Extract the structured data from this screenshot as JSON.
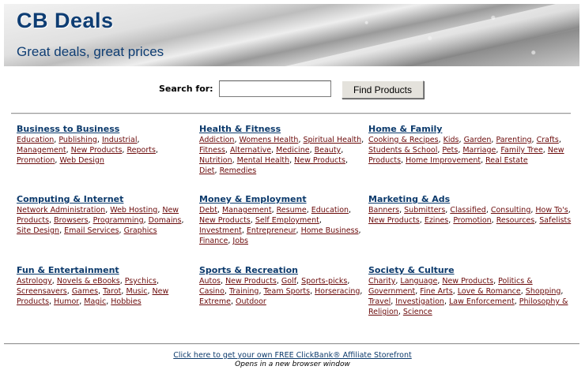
{
  "header": {
    "title": "CB Deals",
    "tagline": "Great deals, great prices"
  },
  "search": {
    "label": "Search for:",
    "value": "",
    "placeholder": "",
    "button_label": "Find Products"
  },
  "categories": [
    {
      "title": "Business to Business",
      "links": [
        "Education",
        "Publishing",
        "Industrial",
        "Management",
        "New Products",
        "Reports",
        "Promotion",
        "Web Design"
      ]
    },
    {
      "title": "Health & Fitness",
      "links": [
        "Addiction",
        "Womens Health",
        "Spiritual Health",
        "Fitness",
        "Alternative",
        "Medicine",
        "Beauty",
        "Nutrition",
        "Mental Health",
        "New Products",
        "Diet",
        "Remedies"
      ]
    },
    {
      "title": "Home & Family",
      "links": [
        "Cooking & Recipes",
        "Kids",
        "Garden",
        "Parenting",
        "Crafts",
        "Students & School",
        "Pets",
        "Marriage",
        "Family Tree",
        "New Products",
        "Home Improvement",
        "Real Estate"
      ]
    },
    {
      "title": "Computing & Internet",
      "links": [
        "Network Administration",
        "Web Hosting",
        "New Products",
        "Browsers",
        "Programming",
        "Domains",
        "Site Design",
        "Email Services",
        "Graphics"
      ]
    },
    {
      "title": "Money & Employment",
      "links": [
        "Debt",
        "Management",
        "Resume",
        "Education",
        "New Products",
        "Self Employment",
        "Investment",
        "Entrepreneur",
        "Home Business",
        "Finance",
        "Jobs"
      ]
    },
    {
      "title": "Marketing & Ads",
      "links": [
        "Banners",
        "Submitters",
        "Classified",
        "Consulting",
        "How To's",
        "New Products",
        "Ezines",
        "Promotion",
        "Resources",
        "Safelists"
      ]
    },
    {
      "title": "Fun & Entertainment",
      "links": [
        "Astrology",
        "Novels & eBooks",
        "Psychics",
        "Screensavers",
        "Games",
        "Tarot",
        "Music",
        "New Products",
        "Humor",
        "Magic",
        "Hobbies"
      ]
    },
    {
      "title": "Sports & Recreation",
      "links": [
        "Autos",
        "New Products",
        "Golf",
        "Sports-picks",
        "Casino",
        "Training",
        "Team Sports",
        "Horseracing",
        "Extreme",
        "Outdoor"
      ]
    },
    {
      "title": "Society & Culture",
      "links": [
        "Charity",
        "Language",
        "New Products",
        "Politics & Government",
        "Fine Arts",
        "Love & Romance",
        "Shopping",
        "Travel",
        "Investigation",
        "Law Enforcement",
        "Philosophy & Religion",
        "Science"
      ]
    }
  ],
  "footer": {
    "link_text": "Click here to get your own FREE ClickBank® Affiliate Storefront",
    "note": "Opens in a new browser window"
  }
}
